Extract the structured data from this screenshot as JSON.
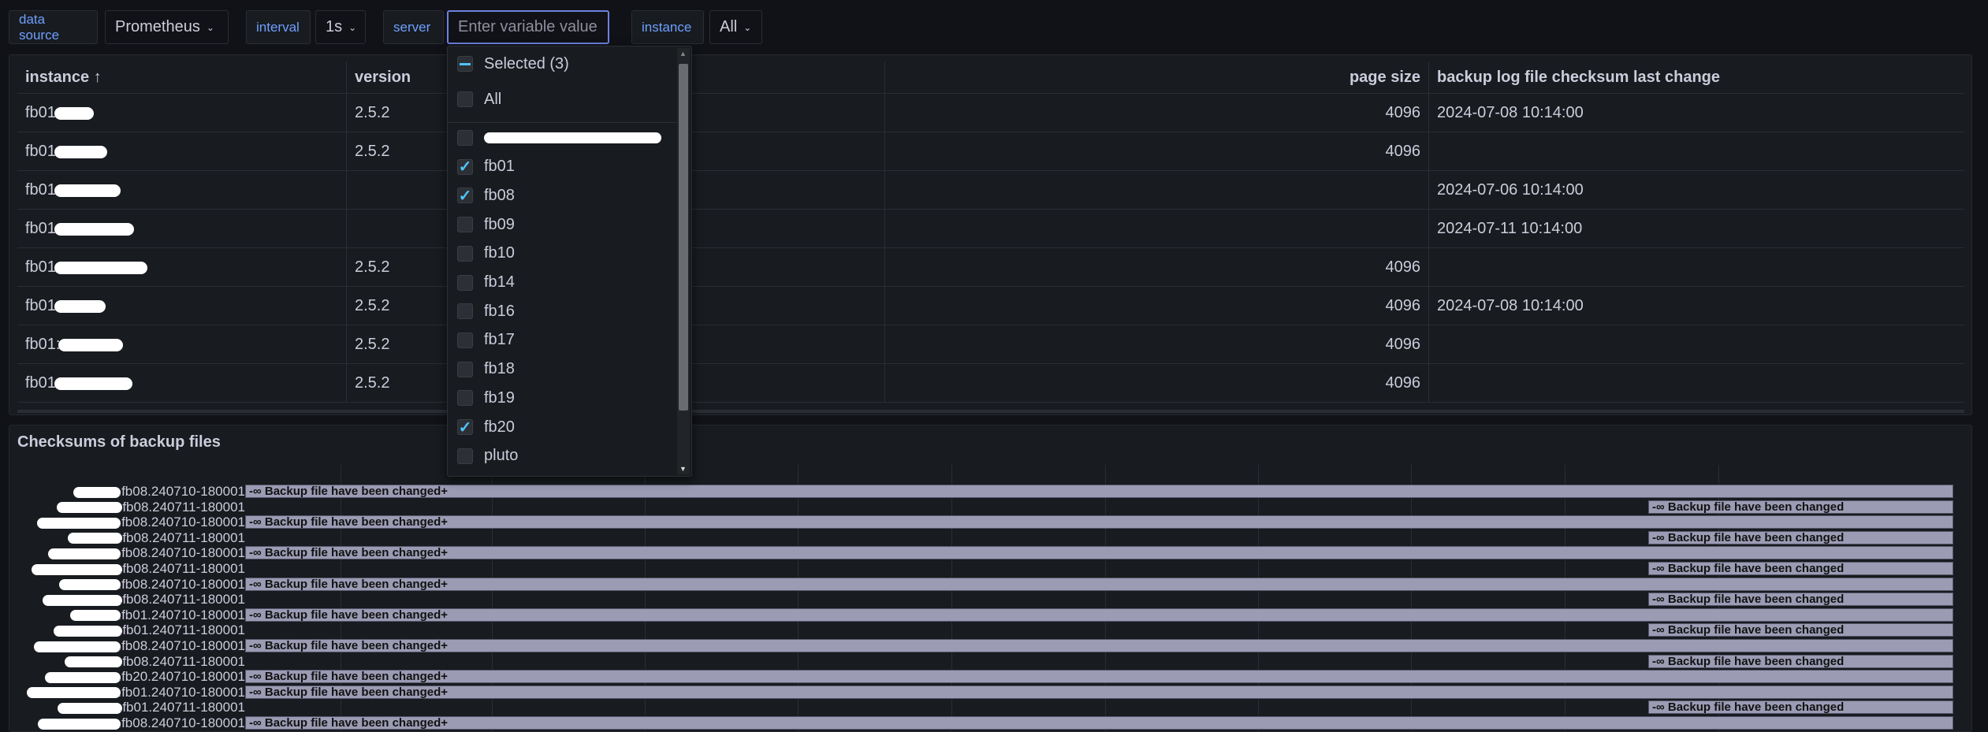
{
  "variables": {
    "datasource": {
      "label": "data source",
      "value": "Prometheus"
    },
    "interval": {
      "label": "interval",
      "value": "1s"
    },
    "server": {
      "label": "server",
      "placeholder": "Enter variable value"
    },
    "instance": {
      "label": "instance",
      "value": "All"
    }
  },
  "table": {
    "headers": {
      "instance": "instance ↑",
      "version": "version",
      "page_size": "page size",
      "backup": "backup log file checksum last change"
    },
    "rows": [
      {
        "instance": "fb01",
        "version": "2.5.2",
        "page_size": "4096",
        "backup": "2024-07-08 10:14:00"
      },
      {
        "instance": "fb01",
        "version": "2.5.2",
        "page_size": "4096",
        "backup": ""
      },
      {
        "instance": "fb01",
        "version": "",
        "page_size": "",
        "backup": "2024-07-06 10:14:00"
      },
      {
        "instance": "fb01",
        "version": "",
        "page_size": "",
        "backup": "2024-07-11 10:14:00"
      },
      {
        "instance": "fb01",
        "version": "2.5.2",
        "page_size": "4096",
        "backup": ""
      },
      {
        "instance": "fb01",
        "version": "2.5.2",
        "page_size": "4096",
        "backup": "2024-07-08 10:14:00"
      },
      {
        "instance": "fb01:",
        "version": "2.5.2",
        "page_size": "4096",
        "backup": ""
      },
      {
        "instance": "fb01",
        "version": "2.5.2",
        "page_size": "4096",
        "backup": ""
      }
    ]
  },
  "dropdown": {
    "selected_label": "Selected (3)",
    "all_label": "All",
    "options": [
      {
        "label": "",
        "checked": false,
        "redacted": true
      },
      {
        "label": "fb01",
        "checked": true
      },
      {
        "label": "fb08",
        "checked": true
      },
      {
        "label": "fb09",
        "checked": false
      },
      {
        "label": "fb10",
        "checked": false
      },
      {
        "label": "fb14",
        "checked": false
      },
      {
        "label": "fb16",
        "checked": false
      },
      {
        "label": "fb17",
        "checked": false
      },
      {
        "label": "fb18",
        "checked": false
      },
      {
        "label": "fb19",
        "checked": false
      },
      {
        "label": "fb20",
        "checked": true
      },
      {
        "label": "pluto",
        "checked": false
      }
    ]
  },
  "checksums": {
    "title": "Checksums of backup files",
    "full_text": "-∞ Backup file have been changed+",
    "right_text": "-∞ Backup file have been changed",
    "rows": [
      {
        "label": ".fb08.240710-180001",
        "kind": "full"
      },
      {
        "label": ".fb08.240711-180001",
        "kind": "right"
      },
      {
        "label": ".fb08.240710-180001",
        "kind": "full"
      },
      {
        "label": ".fb08.240711-180001",
        "kind": "right"
      },
      {
        "label": ".fb08.240710-180001",
        "kind": "full"
      },
      {
        "label": ".fb08.240711-180001",
        "kind": "right"
      },
      {
        "label": ".fb08.240710-180001",
        "kind": "full"
      },
      {
        "label": ".fb08.240711-180001",
        "kind": "right"
      },
      {
        "label": ".fb01.240710-180001",
        "kind": "full"
      },
      {
        "label": ".fb01.240711-180001",
        "kind": "right"
      },
      {
        "label": ".fb08.240710-180001",
        "kind": "full"
      },
      {
        "label": ".fb08.240711-180001",
        "kind": "right"
      },
      {
        "label": ".fb20.240710-180001",
        "kind": "full"
      },
      {
        "label": ".fb01.240710-180001",
        "kind": "full"
      },
      {
        "label": ".fb01.240711-180001",
        "kind": "right"
      },
      {
        "label": ".fb08.240710-180001",
        "kind": "full"
      }
    ],
    "bar_color": "#9b9bb4"
  }
}
